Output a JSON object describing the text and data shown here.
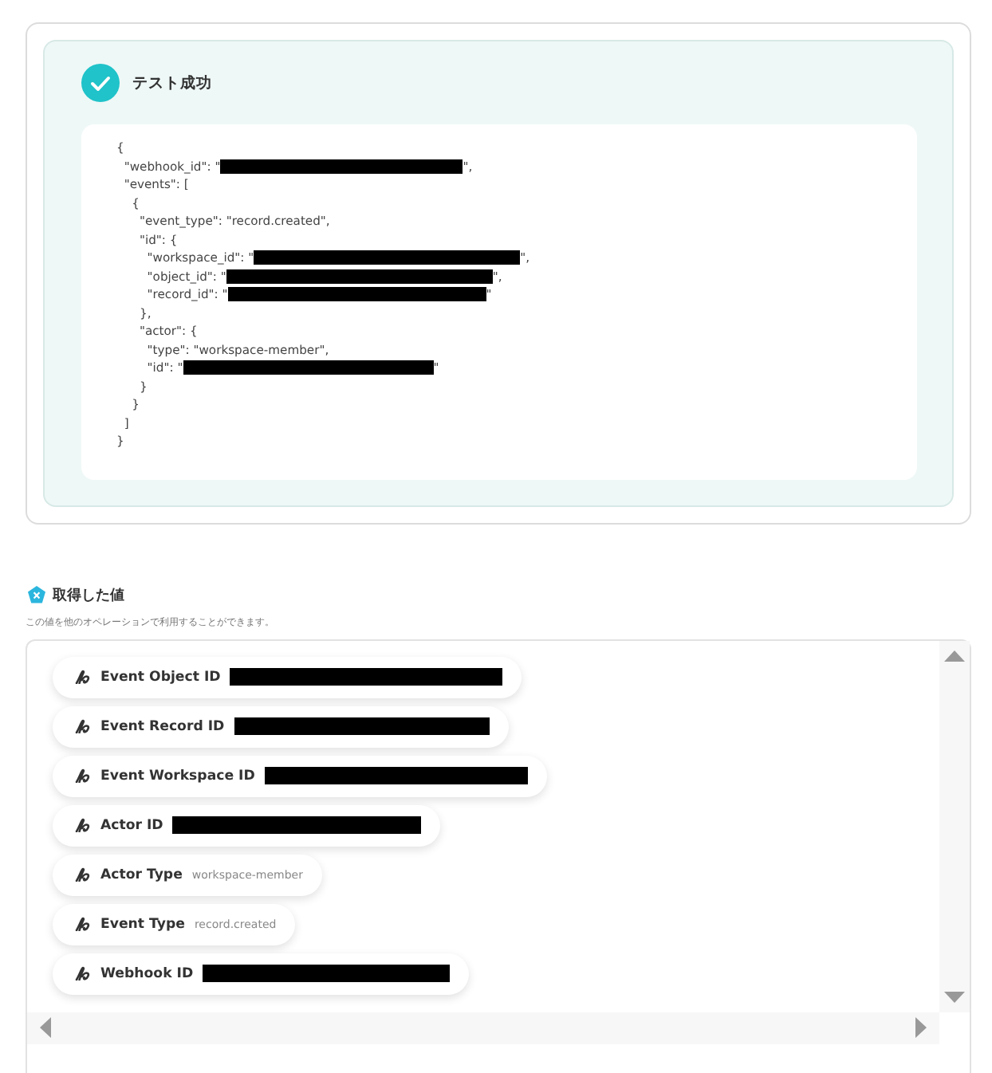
{
  "test_result": {
    "succeeded": true,
    "title": "テスト成功",
    "code_lines": [
      {
        "text": "{"
      },
      {
        "text": "  \"webhook_id\": \"",
        "redacted": true,
        "after": "\","
      },
      {
        "text": "  \"events\": ["
      },
      {
        "text": "    {"
      },
      {
        "text": "      \"event_type\": \"record.created\","
      },
      {
        "text": "      \"id\": {"
      },
      {
        "text": "        \"workspace_id\": \"",
        "redacted": true,
        "after": "\","
      },
      {
        "text": "        \"object_id\": \"",
        "redacted": true,
        "after": "\","
      },
      {
        "text": "        \"record_id\": \"",
        "redacted": true,
        "after": "\""
      },
      {
        "text": "      },"
      },
      {
        "text": "      \"actor\": {"
      },
      {
        "text": "        \"type\": \"workspace-member\","
      },
      {
        "text": "        \"id\": \"",
        "redacted": true,
        "after": "\""
      },
      {
        "text": "      }"
      },
      {
        "text": "    }"
      },
      {
        "text": "  ]"
      },
      {
        "text": "}"
      }
    ]
  },
  "values_section": {
    "title": "取得した値",
    "description": "この値を他のオペレーションで利用することができます。",
    "items": [
      {
        "label": "Event Object ID",
        "redacted": true
      },
      {
        "label": "Event Record ID",
        "redacted": true
      },
      {
        "label": "Event Workspace ID",
        "redacted": true
      },
      {
        "label": "Actor ID",
        "redacted": true
      },
      {
        "label": "Actor Type",
        "redacted": false,
        "value": "workspace-member"
      },
      {
        "label": "Event Type",
        "redacted": false,
        "value": "record.created"
      },
      {
        "label": "Webhook ID",
        "redacted": true
      }
    ]
  }
}
